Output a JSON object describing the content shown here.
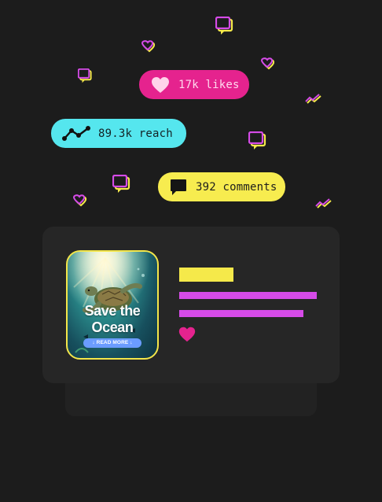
{
  "colors": {
    "background": "#1c1c1c",
    "likes_pill": "#e5238e",
    "reach_pill": "#55e6ee",
    "comments_pill": "#f7ec4f",
    "accent_pink": "#e5238e",
    "accent_purple": "#d64be8",
    "accent_yellow": "#f5e94a"
  },
  "stats": {
    "likes": {
      "icon": "heart-icon",
      "label": "17k likes"
    },
    "reach": {
      "icon": "trend-line-icon",
      "label": "89.3k reach"
    },
    "comments": {
      "icon": "comment-bubble-icon",
      "label": "392 comments"
    }
  },
  "card": {
    "poster": {
      "title_line1": "Save the",
      "title_line2": "Ocean",
      "button_label": "↓ READ MORE ↓"
    },
    "like_icon": "heart-icon"
  }
}
